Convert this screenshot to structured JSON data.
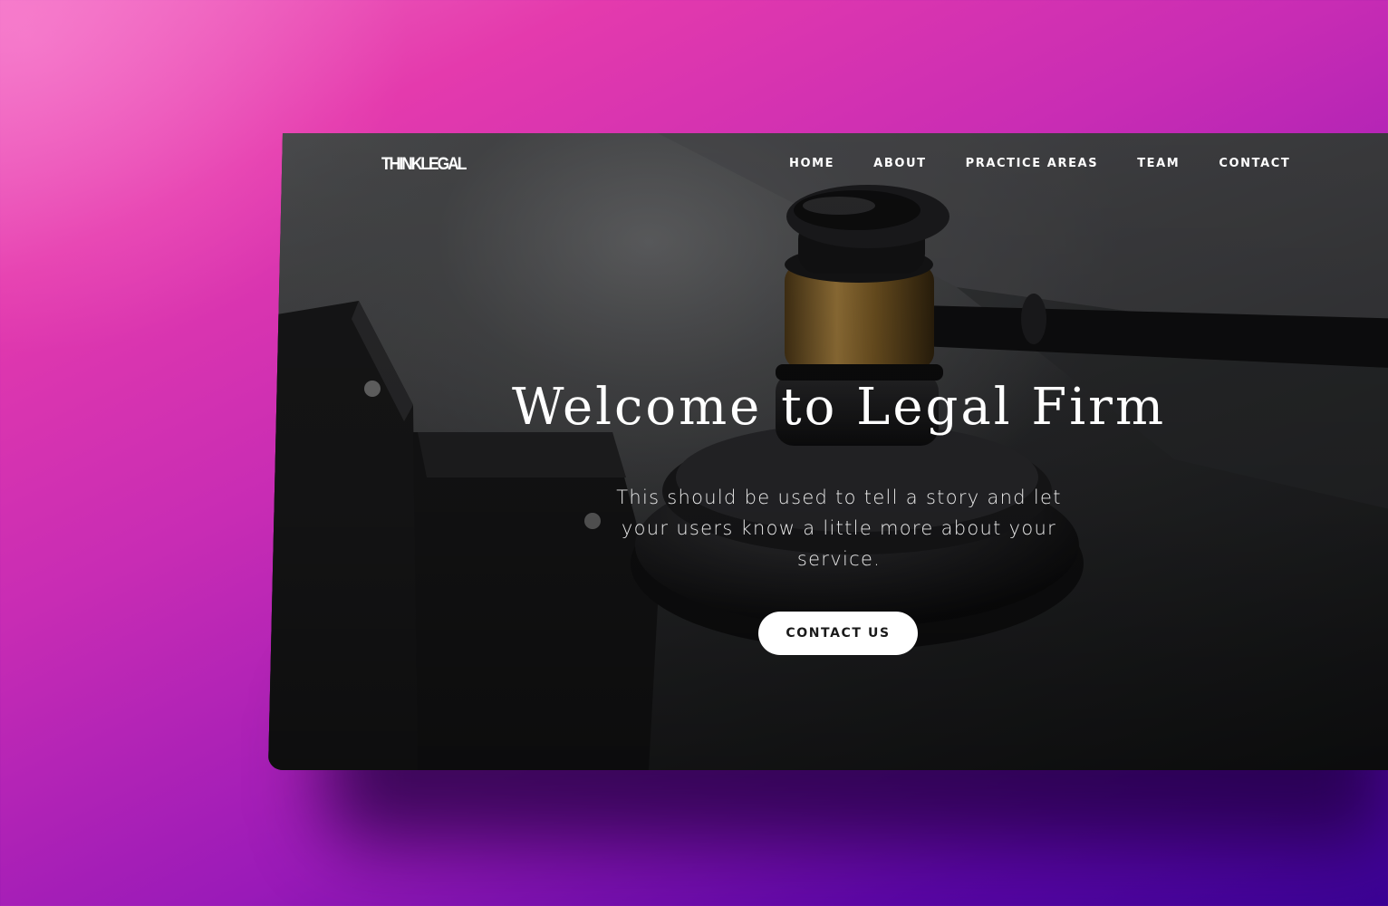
{
  "site": {
    "logo": "THINKLEGAL",
    "nav": [
      {
        "label": "HOME"
      },
      {
        "label": "ABOUT"
      },
      {
        "label": "PRACTICE AREAS"
      },
      {
        "label": "TEAM"
      },
      {
        "label": "CONTACT"
      }
    ]
  },
  "hero": {
    "title": "Welcome to Legal Firm",
    "subtitle": "This should be used to tell a story and let your users know a little more about your service.",
    "cta_label": "CONTACT US",
    "image_subject": "judge-gavel-photo"
  },
  "colors": {
    "background_start": "#f06ac0",
    "background_end": "#3a0294",
    "card_dark": "#1b1c1e",
    "cta_bg": "#ffffff",
    "gavel_band": "#8a6a2e"
  }
}
